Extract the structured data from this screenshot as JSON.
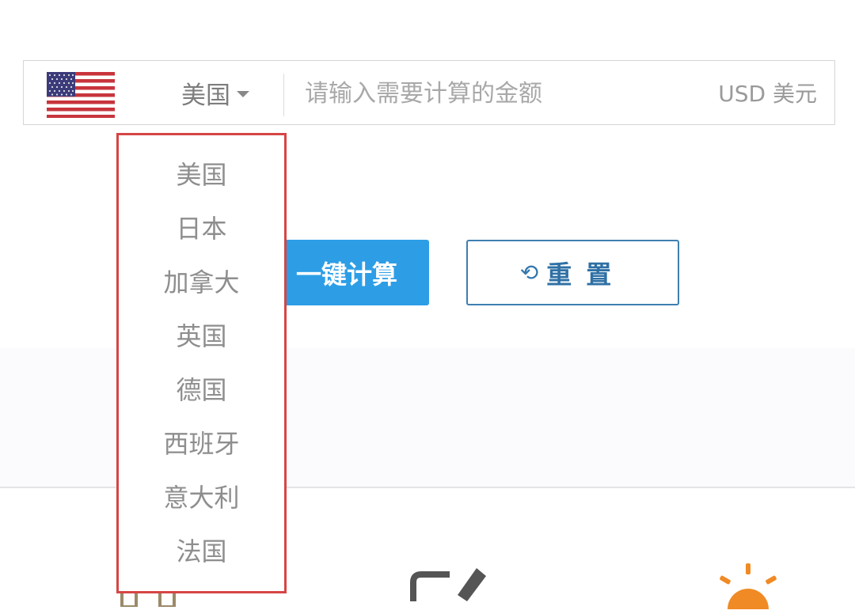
{
  "converter": {
    "selected_country": "美国",
    "amount_placeholder": "请输入需要计算的金额",
    "currency": "USD 美元",
    "flag_icon": "us-flag-icon",
    "caret_icon": "caret-down-icon"
  },
  "actions": {
    "calculate_label": "一键计算",
    "reset_label": "重置",
    "reset_icon": "refresh-icon"
  },
  "dropdown": {
    "options": [
      "美国",
      "日本",
      "加拿大",
      "英国",
      "德国",
      "西班牙",
      "意大利",
      "法国"
    ]
  },
  "colors": {
    "primary_blue": "#2d9ee6",
    "reset_border": "#3e7fb1",
    "dropdown_highlight": "#d64545",
    "text_gray": "#8e8e8e"
  },
  "bottom_icons": [
    "document-icon",
    "edit-icon",
    "lightbulb-icon"
  ]
}
